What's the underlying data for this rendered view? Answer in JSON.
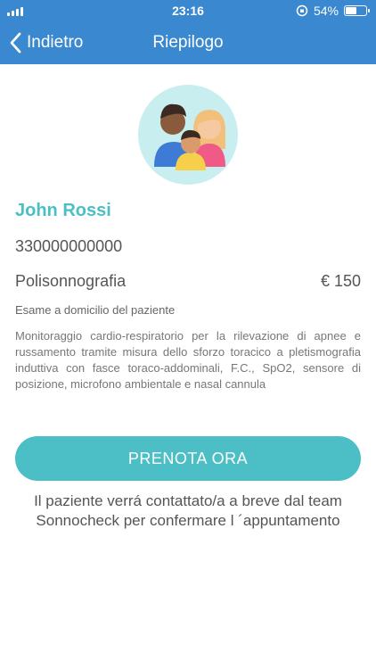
{
  "status_bar": {
    "time": "23:16",
    "battery_text": "54%",
    "battery_level": 0.54
  },
  "nav": {
    "back_label": "Indietro",
    "title": "Riepilogo"
  },
  "patient": {
    "name": "John Rossi",
    "phone": "330000000000"
  },
  "exam": {
    "name": "Polisonnografia",
    "price": "€ 150",
    "subtitle": "Esame a domicilio del paziente",
    "description": "Monitoraggio cardio-respiratorio per la rilevazione di apnee e russamento tramite misura dello sforzo toracico a pletismografia induttiva con fasce toraco-addominali, F.C., SpO2, sensore di posizione, microfono ambientale e nasal cannula"
  },
  "cta": {
    "label": "PRENOTA ORA"
  },
  "note": "Il paziente verrá contattato/a a breve dal team Sonnocheck per confermare l ´appuntamento",
  "colors": {
    "header": "#3a88cf",
    "accent": "#4bbfc5"
  },
  "icons": {
    "back": "chevron-left-icon",
    "avatar": "family-avatar-icon"
  }
}
